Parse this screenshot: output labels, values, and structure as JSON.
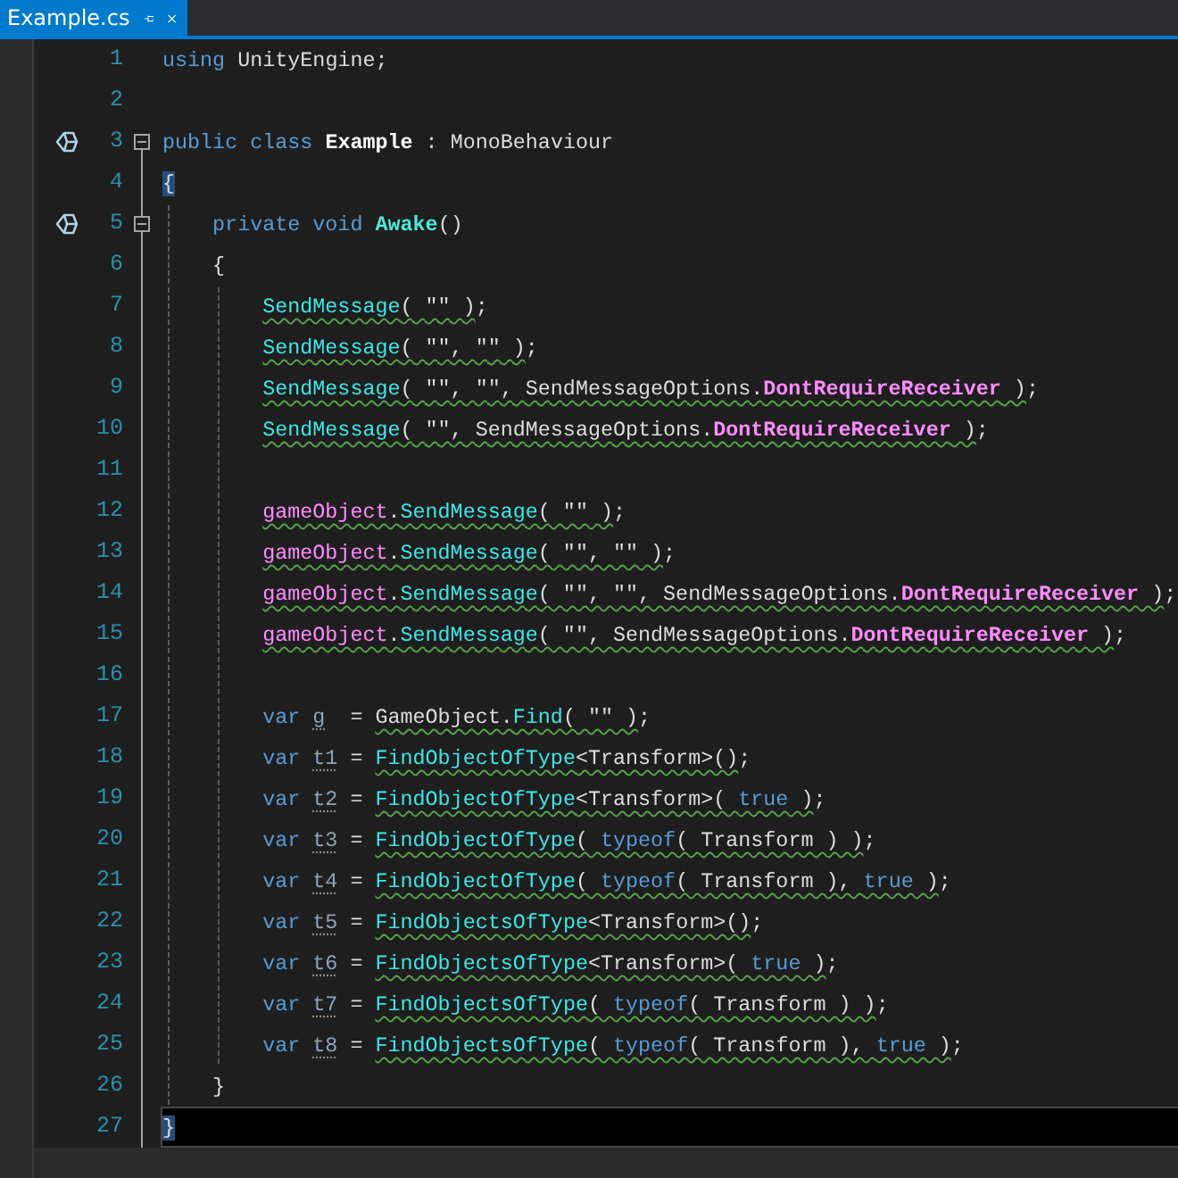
{
  "tab": {
    "label": "Example.cs",
    "selected": true
  },
  "lines": [
    {
      "number": "1",
      "current": false,
      "tokens": [
        {
          "text": "using ",
          "kind": "keyword",
          "squiggle": false
        },
        {
          "text": "UnityEngine;",
          "kind": "plain",
          "squiggle": false
        }
      ]
    },
    {
      "number": "2",
      "current": false
    },
    {
      "number": "3",
      "current": false,
      "marker": true,
      "expanded": true,
      "tokens": [
        {
          "text": "public class ",
          "kind": "keyword",
          "squiggle": false
        },
        {
          "text": "Example",
          "kind": "decl",
          "squiggle": false
        },
        {
          "text": " : MonoBehaviour",
          "kind": "plain",
          "squiggle": false
        }
      ]
    },
    {
      "number": "4",
      "current": false,
      "tokens": [
        {
          "text": "{",
          "kind": "brace-match",
          "squiggle": false
        }
      ],
      "children": [
        {
          "number": "5",
          "current": false,
          "marker": true,
          "expanded": true,
          "tokens": [
            {
              "text": "private void ",
              "kind": "keyword",
              "squiggle": false
            },
            {
              "text": "Awake",
              "kind": "method-decl",
              "squiggle": false
            },
            {
              "text": "()",
              "kind": "plain",
              "squiggle": false
            }
          ]
        },
        {
          "number": "6",
          "current": false,
          "tokens": [
            {
              "text": "{",
              "kind": "plain",
              "squiggle": false
            }
          ],
          "children": [
            {
              "number": "7",
              "current": false,
              "tokens": [
                {
                  "text": "SendMessage",
                  "kind": "method",
                  "squiggle": true
                },
                {
                  "text": "( \"\" )",
                  "kind": "plain",
                  "squiggle": true
                },
                {
                  "text": ";",
                  "kind": "plain",
                  "squiggle": false
                }
              ]
            },
            {
              "number": "8",
              "current": false,
              "tokens": [
                {
                  "text": "SendMessage",
                  "kind": "method",
                  "squiggle": true
                },
                {
                  "text": "( \"\", \"\" )",
                  "kind": "plain",
                  "squiggle": true
                },
                {
                  "text": ";",
                  "kind": "plain",
                  "squiggle": false
                }
              ]
            },
            {
              "number": "9",
              "current": false,
              "tokens": [
                {
                  "text": "SendMessage",
                  "kind": "method",
                  "squiggle": true
                },
                {
                  "text": "( \"\", \"\", SendMessageOptions.",
                  "kind": "plain",
                  "squiggle": true
                },
                {
                  "text": "DontRequireReceiver",
                  "kind": "enum",
                  "squiggle": true
                },
                {
                  "text": " )",
                  "kind": "plain",
                  "squiggle": true
                },
                {
                  "text": ";",
                  "kind": "plain",
                  "squiggle": false
                }
              ]
            },
            {
              "number": "10",
              "current": false,
              "tokens": [
                {
                  "text": "SendMessage",
                  "kind": "method",
                  "squiggle": true
                },
                {
                  "text": "( \"\", SendMessageOptions.",
                  "kind": "plain",
                  "squiggle": true
                },
                {
                  "text": "DontRequireReceiver",
                  "kind": "enum",
                  "squiggle": true
                },
                {
                  "text": " )",
                  "kind": "plain",
                  "squiggle": true
                },
                {
                  "text": ";",
                  "kind": "plain",
                  "squiggle": false
                }
              ]
            },
            {
              "number": "11",
              "current": false
            },
            {
              "number": "12",
              "current": false,
              "tokens": [
                {
                  "text": "gameObject",
                  "kind": "member",
                  "squiggle": true
                },
                {
                  "text": ".",
                  "kind": "plain",
                  "squiggle": true
                },
                {
                  "text": "SendMessage",
                  "kind": "method",
                  "squiggle": true
                },
                {
                  "text": "( \"\" )",
                  "kind": "plain",
                  "squiggle": true
                },
                {
                  "text": ";",
                  "kind": "plain",
                  "squiggle": false
                }
              ]
            },
            {
              "number": "13",
              "current": false,
              "tokens": [
                {
                  "text": "gameObject",
                  "kind": "member",
                  "squiggle": true
                },
                {
                  "text": ".",
                  "kind": "plain",
                  "squiggle": true
                },
                {
                  "text": "SendMessage",
                  "kind": "method",
                  "squiggle": true
                },
                {
                  "text": "( \"\", \"\" )",
                  "kind": "plain",
                  "squiggle": true
                },
                {
                  "text": ";",
                  "kind": "plain",
                  "squiggle": false
                }
              ]
            },
            {
              "number": "14",
              "current": false,
              "tokens": [
                {
                  "text": "gameObject",
                  "kind": "member",
                  "squiggle": true
                },
                {
                  "text": ".",
                  "kind": "plain",
                  "squiggle": true
                },
                {
                  "text": "SendMessage",
                  "kind": "method",
                  "squiggle": true
                },
                {
                  "text": "( \"\", \"\", SendMessageOptions.",
                  "kind": "plain",
                  "squiggle": true
                },
                {
                  "text": "DontRequireReceiver",
                  "kind": "enum",
                  "squiggle": true
                },
                {
                  "text": " )",
                  "kind": "plain",
                  "squiggle": true
                },
                {
                  "text": ";",
                  "kind": "plain",
                  "squiggle": false
                }
              ]
            },
            {
              "number": "15",
              "current": false,
              "tokens": [
                {
                  "text": "gameObject",
                  "kind": "member",
                  "squiggle": true
                },
                {
                  "text": ".",
                  "kind": "plain",
                  "squiggle": true
                },
                {
                  "text": "SendMessage",
                  "kind": "method",
                  "squiggle": true
                },
                {
                  "text": "( \"\", SendMessageOptions.",
                  "kind": "plain",
                  "squiggle": true
                },
                {
                  "text": "DontRequireReceiver",
                  "kind": "enum",
                  "squiggle": true
                },
                {
                  "text": " )",
                  "kind": "plain",
                  "squiggle": true
                },
                {
                  "text": ";",
                  "kind": "plain",
                  "squiggle": false
                }
              ]
            },
            {
              "number": "16",
              "current": false
            },
            {
              "number": "17",
              "current": false,
              "tokens": [
                {
                  "text": "var ",
                  "kind": "keyword",
                  "squiggle": false
                },
                {
                  "text": "g",
                  "kind": "variable",
                  "squiggle": false
                },
                {
                  "text": "  = ",
                  "kind": "plain",
                  "squiggle": false
                },
                {
                  "text": "GameObject.",
                  "kind": "plain",
                  "squiggle": true
                },
                {
                  "text": "Find",
                  "kind": "method",
                  "squiggle": true
                },
                {
                  "text": "( \"\" )",
                  "kind": "plain",
                  "squiggle": true
                },
                {
                  "text": ";",
                  "kind": "plain",
                  "squiggle": false
                }
              ]
            },
            {
              "number": "18",
              "current": false,
              "tokens": [
                {
                  "text": "var ",
                  "kind": "keyword",
                  "squiggle": false
                },
                {
                  "text": "t1",
                  "kind": "variable",
                  "squiggle": false
                },
                {
                  "text": " = ",
                  "kind": "plain",
                  "squiggle": false
                },
                {
                  "text": "FindObjectOfType",
                  "kind": "method",
                  "squiggle": true
                },
                {
                  "text": "<Transform>()",
                  "kind": "plain",
                  "squiggle": true
                },
                {
                  "text": ";",
                  "kind": "plain",
                  "squiggle": false
                }
              ]
            },
            {
              "number": "19",
              "current": false,
              "tokens": [
                {
                  "text": "var ",
                  "kind": "keyword",
                  "squiggle": false
                },
                {
                  "text": "t2",
                  "kind": "variable",
                  "squiggle": false
                },
                {
                  "text": " = ",
                  "kind": "plain",
                  "squiggle": false
                },
                {
                  "text": "FindObjectOfType",
                  "kind": "method",
                  "squiggle": true
                },
                {
                  "text": "<Transform>( ",
                  "kind": "plain",
                  "squiggle": true
                },
                {
                  "text": "true",
                  "kind": "keyword",
                  "squiggle": true
                },
                {
                  "text": " )",
                  "kind": "plain",
                  "squiggle": true
                },
                {
                  "text": ";",
                  "kind": "plain",
                  "squiggle": false
                }
              ]
            },
            {
              "number": "20",
              "current": false,
              "tokens": [
                {
                  "text": "var ",
                  "kind": "keyword",
                  "squiggle": false
                },
                {
                  "text": "t3",
                  "kind": "variable",
                  "squiggle": false
                },
                {
                  "text": " = ",
                  "kind": "plain",
                  "squiggle": false
                },
                {
                  "text": "FindObjectOfType",
                  "kind": "method",
                  "squiggle": true
                },
                {
                  "text": "( ",
                  "kind": "plain",
                  "squiggle": true
                },
                {
                  "text": "typeof",
                  "kind": "keyword",
                  "squiggle": true
                },
                {
                  "text": "( Transform ) )",
                  "kind": "plain",
                  "squiggle": true
                },
                {
                  "text": ";",
                  "kind": "plain",
                  "squiggle": false
                }
              ]
            },
            {
              "number": "21",
              "current": false,
              "tokens": [
                {
                  "text": "var ",
                  "kind": "keyword",
                  "squiggle": false
                },
                {
                  "text": "t4",
                  "kind": "variable",
                  "squiggle": false
                },
                {
                  "text": " = ",
                  "kind": "plain",
                  "squiggle": false
                },
                {
                  "text": "FindObjectOfType",
                  "kind": "method",
                  "squiggle": true
                },
                {
                  "text": "( ",
                  "kind": "plain",
                  "squiggle": true
                },
                {
                  "text": "typeof",
                  "kind": "keyword",
                  "squiggle": true
                },
                {
                  "text": "( Transform ), ",
                  "kind": "plain",
                  "squiggle": true
                },
                {
                  "text": "true",
                  "kind": "keyword",
                  "squiggle": true
                },
                {
                  "text": " )",
                  "kind": "plain",
                  "squiggle": true
                },
                {
                  "text": ";",
                  "kind": "plain",
                  "squiggle": false
                }
              ]
            },
            {
              "number": "22",
              "current": false,
              "tokens": [
                {
                  "text": "var ",
                  "kind": "keyword",
                  "squiggle": false
                },
                {
                  "text": "t5",
                  "kind": "variable",
                  "squiggle": false
                },
                {
                  "text": " = ",
                  "kind": "plain",
                  "squiggle": false
                },
                {
                  "text": "FindObjectsOfType",
                  "kind": "method",
                  "squiggle": true
                },
                {
                  "text": "<Transform>()",
                  "kind": "plain",
                  "squiggle": true
                },
                {
                  "text": ";",
                  "kind": "plain",
                  "squiggle": false
                }
              ]
            },
            {
              "number": "23",
              "current": false,
              "tokens": [
                {
                  "text": "var ",
                  "kind": "keyword",
                  "squiggle": false
                },
                {
                  "text": "t6",
                  "kind": "variable",
                  "squiggle": false
                },
                {
                  "text": " = ",
                  "kind": "plain",
                  "squiggle": false
                },
                {
                  "text": "FindObjectsOfType",
                  "kind": "method",
                  "squiggle": true
                },
                {
                  "text": "<Transform>( ",
                  "kind": "plain",
                  "squiggle": true
                },
                {
                  "text": "true",
                  "kind": "keyword",
                  "squiggle": true
                },
                {
                  "text": " )",
                  "kind": "plain",
                  "squiggle": true
                },
                {
                  "text": ";",
                  "kind": "plain",
                  "squiggle": false
                }
              ]
            },
            {
              "number": "24",
              "current": false,
              "tokens": [
                {
                  "text": "var ",
                  "kind": "keyword",
                  "squiggle": false
                },
                {
                  "text": "t7",
                  "kind": "variable",
                  "squiggle": false
                },
                {
                  "text": " = ",
                  "kind": "plain",
                  "squiggle": false
                },
                {
                  "text": "FindObjectsOfType",
                  "kind": "method",
                  "squiggle": true
                },
                {
                  "text": "( ",
                  "kind": "plain",
                  "squiggle": true
                },
                {
                  "text": "typeof",
                  "kind": "keyword",
                  "squiggle": true
                },
                {
                  "text": "( Transform ) )",
                  "kind": "plain",
                  "squiggle": true
                },
                {
                  "text": ";",
                  "kind": "plain",
                  "squiggle": false
                }
              ]
            },
            {
              "number": "25",
              "current": false,
              "tokens": [
                {
                  "text": "var ",
                  "kind": "keyword",
                  "squiggle": false
                },
                {
                  "text": "t8",
                  "kind": "variable",
                  "squiggle": false
                },
                {
                  "text": " = ",
                  "kind": "plain",
                  "squiggle": false
                },
                {
                  "text": "FindObjectsOfType",
                  "kind": "method",
                  "squiggle": true
                },
                {
                  "text": "( ",
                  "kind": "plain",
                  "squiggle": true
                },
                {
                  "text": "typeof",
                  "kind": "keyword",
                  "squiggle": true
                },
                {
                  "text": "( Transform ), ",
                  "kind": "plain",
                  "squiggle": true
                },
                {
                  "text": "true",
                  "kind": "keyword",
                  "squiggle": true
                },
                {
                  "text": " )",
                  "kind": "plain",
                  "squiggle": true
                },
                {
                  "text": ";",
                  "kind": "plain",
                  "squiggle": false
                }
              ]
            }
          ]
        },
        {
          "number": "26",
          "current": false,
          "tokens": [
            {
              "text": "}",
              "kind": "plain",
              "squiggle": false
            }
          ]
        }
      ]
    },
    {
      "number": "27",
      "current": true,
      "tokens": [
        {
          "text": "}",
          "kind": "brace-match",
          "squiggle": false
        }
      ]
    }
  ]
}
